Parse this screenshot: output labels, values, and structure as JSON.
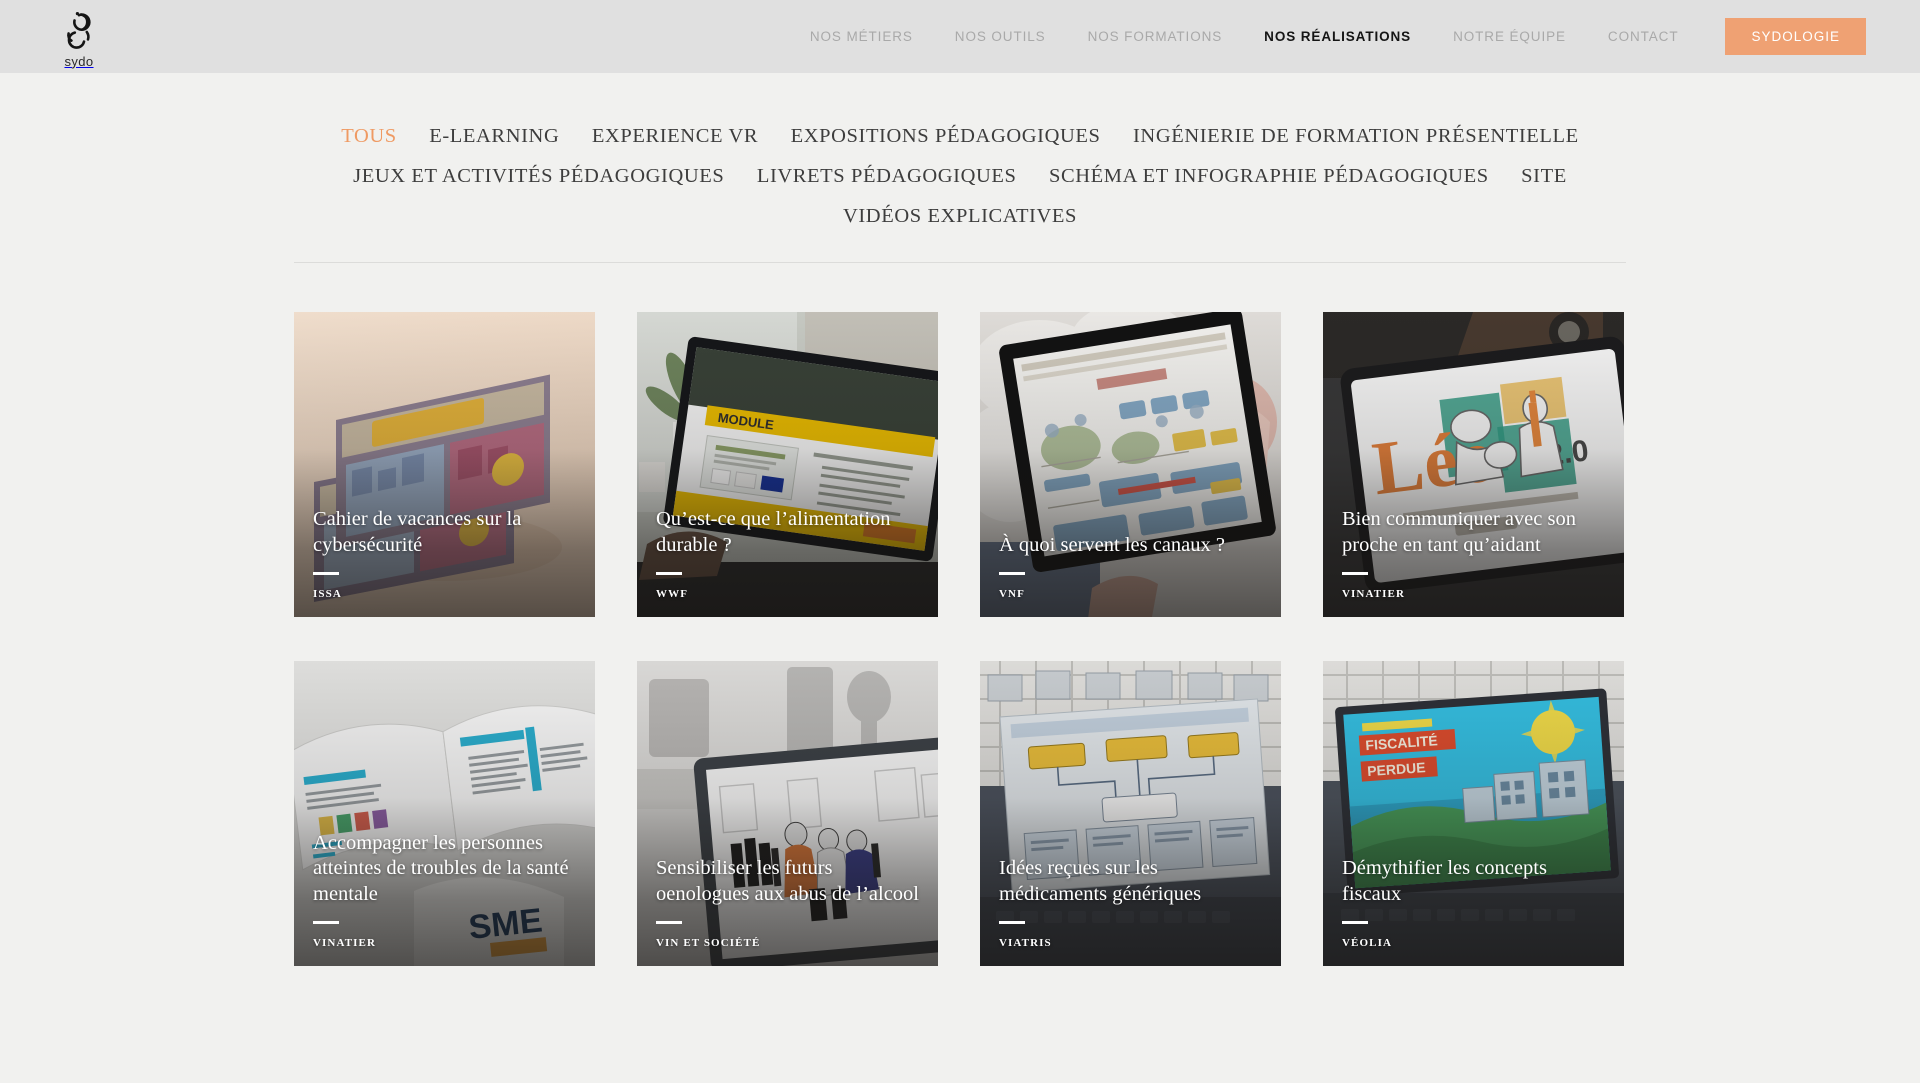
{
  "header": {
    "brand": {
      "word": "sydo",
      "logo_icon": "sydo-logo-icon"
    },
    "nav": [
      {
        "label": "NOS MÉTIERS",
        "active": false
      },
      {
        "label": "NOS OUTILS",
        "active": false
      },
      {
        "label": "NOS FORMATIONS",
        "active": false
      },
      {
        "label": "NOS RÉALISATIONS",
        "active": true
      },
      {
        "label": "NOTRE ÉQUIPE",
        "active": false
      },
      {
        "label": "CONTACT",
        "active": false
      }
    ],
    "cta": {
      "label": "SYDOLOGIE",
      "color": "#efa173"
    }
  },
  "filters": {
    "active_color": "#ef9a63",
    "rows": [
      [
        {
          "label": "TOUS",
          "active": true
        },
        {
          "label": "E-LEARNING",
          "active": false
        },
        {
          "label": "EXPERIENCE VR",
          "active": false
        },
        {
          "label": "EXPOSITIONS PÉDAGOGIQUES",
          "active": false
        },
        {
          "label": "INGÉNIERIE DE FORMATION PRÉSENTIELLE",
          "active": false
        }
      ],
      [
        {
          "label": "JEUX ET ACTIVITÉS PÉDAGOGIQUES",
          "active": false
        },
        {
          "label": "LIVRETS PÉDAGOGIQUES",
          "active": false
        },
        {
          "label": "SCHÉMA ET INFOGRAPHIE PÉDAGOGIQUES",
          "active": false
        },
        {
          "label": "SITE",
          "active": false
        },
        {
          "label": "VIDÉOS EXPLICATIVES",
          "active": false
        }
      ]
    ]
  },
  "projects": [
    {
      "title": "Cahier de vacances sur la cybersécurité",
      "client": "ISSA",
      "media": "magazines-on-peach-background"
    },
    {
      "title": "Qu’est-ce que l’alimentation durable ?",
      "client": "WWF",
      "media": "laptop-elearning-module-yellow"
    },
    {
      "title": "À quoi servent les canaux ?",
      "client": "VNF",
      "media": "tablet-illustrated-infographic-held-in-hand"
    },
    {
      "title": "Bien communiquer avec son proche en tant qu’aidant",
      "client": "VINATIER",
      "media": "tablet-leo-2-0-orange-logo-on-desk"
    },
    {
      "title": "Accompagner les personnes atteintes de troubles de la santé mentale",
      "client": "VINATIER",
      "media": "open-printed-booklet-sme"
    },
    {
      "title": "Sensibiliser les futurs oenologues aux abus de l’alcool",
      "client": "VIN ET SOCIÉTÉ",
      "media": "tablet-illustration-characters-in-bar"
    },
    {
      "title": "Idées reçues sur les médicaments génériques",
      "client": "VIATRIS",
      "media": "laptop-poster-diagram-on-desk"
    },
    {
      "title": "Démythifier les concepts fiscaux",
      "client": "VÉOLIA",
      "media": "laptop-comic-fiscalite-perdue"
    }
  ]
}
